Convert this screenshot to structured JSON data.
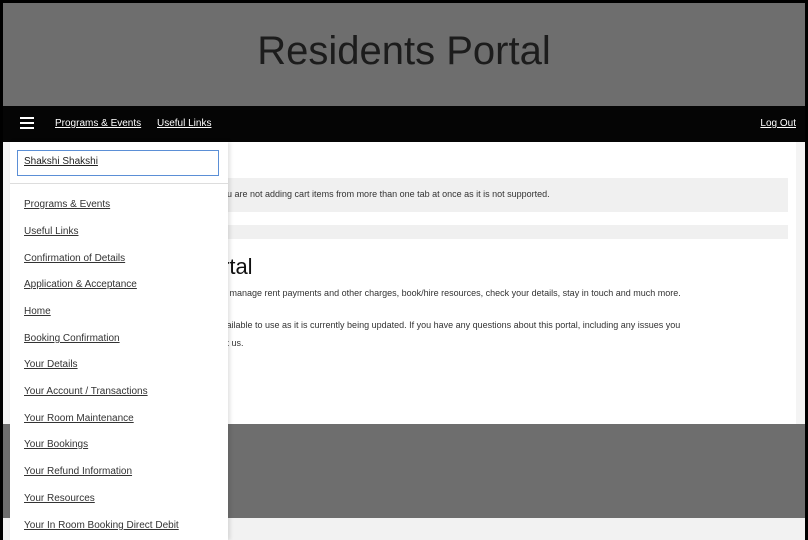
{
  "header": {
    "title": "Residents Portal"
  },
  "navbar": {
    "menu_icon": "hamburger-menu-icon",
    "links": [
      "Programs & Events",
      "Useful Links"
    ],
    "logout": "Log Out"
  },
  "content": {
    "notice": "ou are not adding cart items from more than one tab at once as it is not supported.",
    "heading": "rtal",
    "para1": "d manage rent payments and other charges, book/hire resources, check your details, stay in touch and much more.",
    "para2": "vailable to use as it is currently being updated. If you have any questions about this portal, including any issues you",
    "para3": "ct us."
  },
  "drawer": {
    "user": "Shakshi Shakshi",
    "items": [
      "Programs & Events",
      "Useful Links",
      "Confirmation of Details",
      "Application & Acceptance",
      "Home",
      "Booking Confirmation",
      "Your Details",
      "Your Account / Transactions",
      "Your Room Maintenance",
      "Your Bookings",
      "Your Refund Information",
      "Your Resources",
      "Your In Room Booking Direct Debit"
    ]
  },
  "colors": {
    "header_bg": "#6e6e6e",
    "navbar_bg": "#050505",
    "focus_border": "#5b8fd6"
  }
}
